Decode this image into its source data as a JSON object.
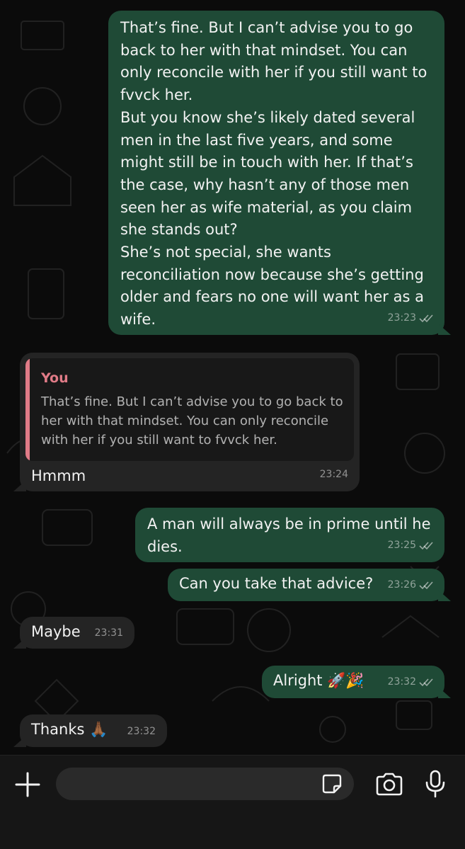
{
  "messages": [
    {
      "direction": "outgoing",
      "text": "That’s fine. But I can’t advise you to go back to her with that mindset. You can only reconcile with her if you still want to fvvck her.\nBut you know she’s likely dated several men in the last five years, and some might still be in touch with her. If that’s the case, why hasn’t any of those men seen her as wife material, as you claim she stands out?\nShe’s not special, she wants reconciliation now because she’s getting older and fears no one will want her as a wife.",
      "time": "23:23",
      "status": "read"
    },
    {
      "direction": "incoming",
      "quote": {
        "author": "You",
        "text": "That’s fine. But I can’t advise you to go back to her with that mindset. You can only reconcile with her if you still want to fvvck her."
      },
      "text": "Hmmm",
      "time": "23:24"
    },
    {
      "direction": "outgoing",
      "text": "A man will always be in prime until he dies.",
      "time": "23:25",
      "status": "read"
    },
    {
      "direction": "outgoing",
      "text": "Can you take that advice?",
      "time": "23:26",
      "status": "read"
    },
    {
      "direction": "incoming",
      "text": "Maybe",
      "time": "23:31"
    },
    {
      "direction": "outgoing",
      "text": "Alright 🚀🎉",
      "time": "23:32",
      "status": "read"
    },
    {
      "direction": "incoming",
      "text": "Thanks 🙏🏾",
      "time": "23:32"
    }
  ],
  "composer": {
    "input_value": "",
    "icons": [
      "plus-icon",
      "sticker-icon",
      "camera-icon",
      "microphone-icon"
    ]
  },
  "colors": {
    "outgoing_bubble": "#1f4a36",
    "incoming_bubble": "#242424",
    "quote_accent": "#e07b87",
    "background": "#0b0b0b"
  }
}
